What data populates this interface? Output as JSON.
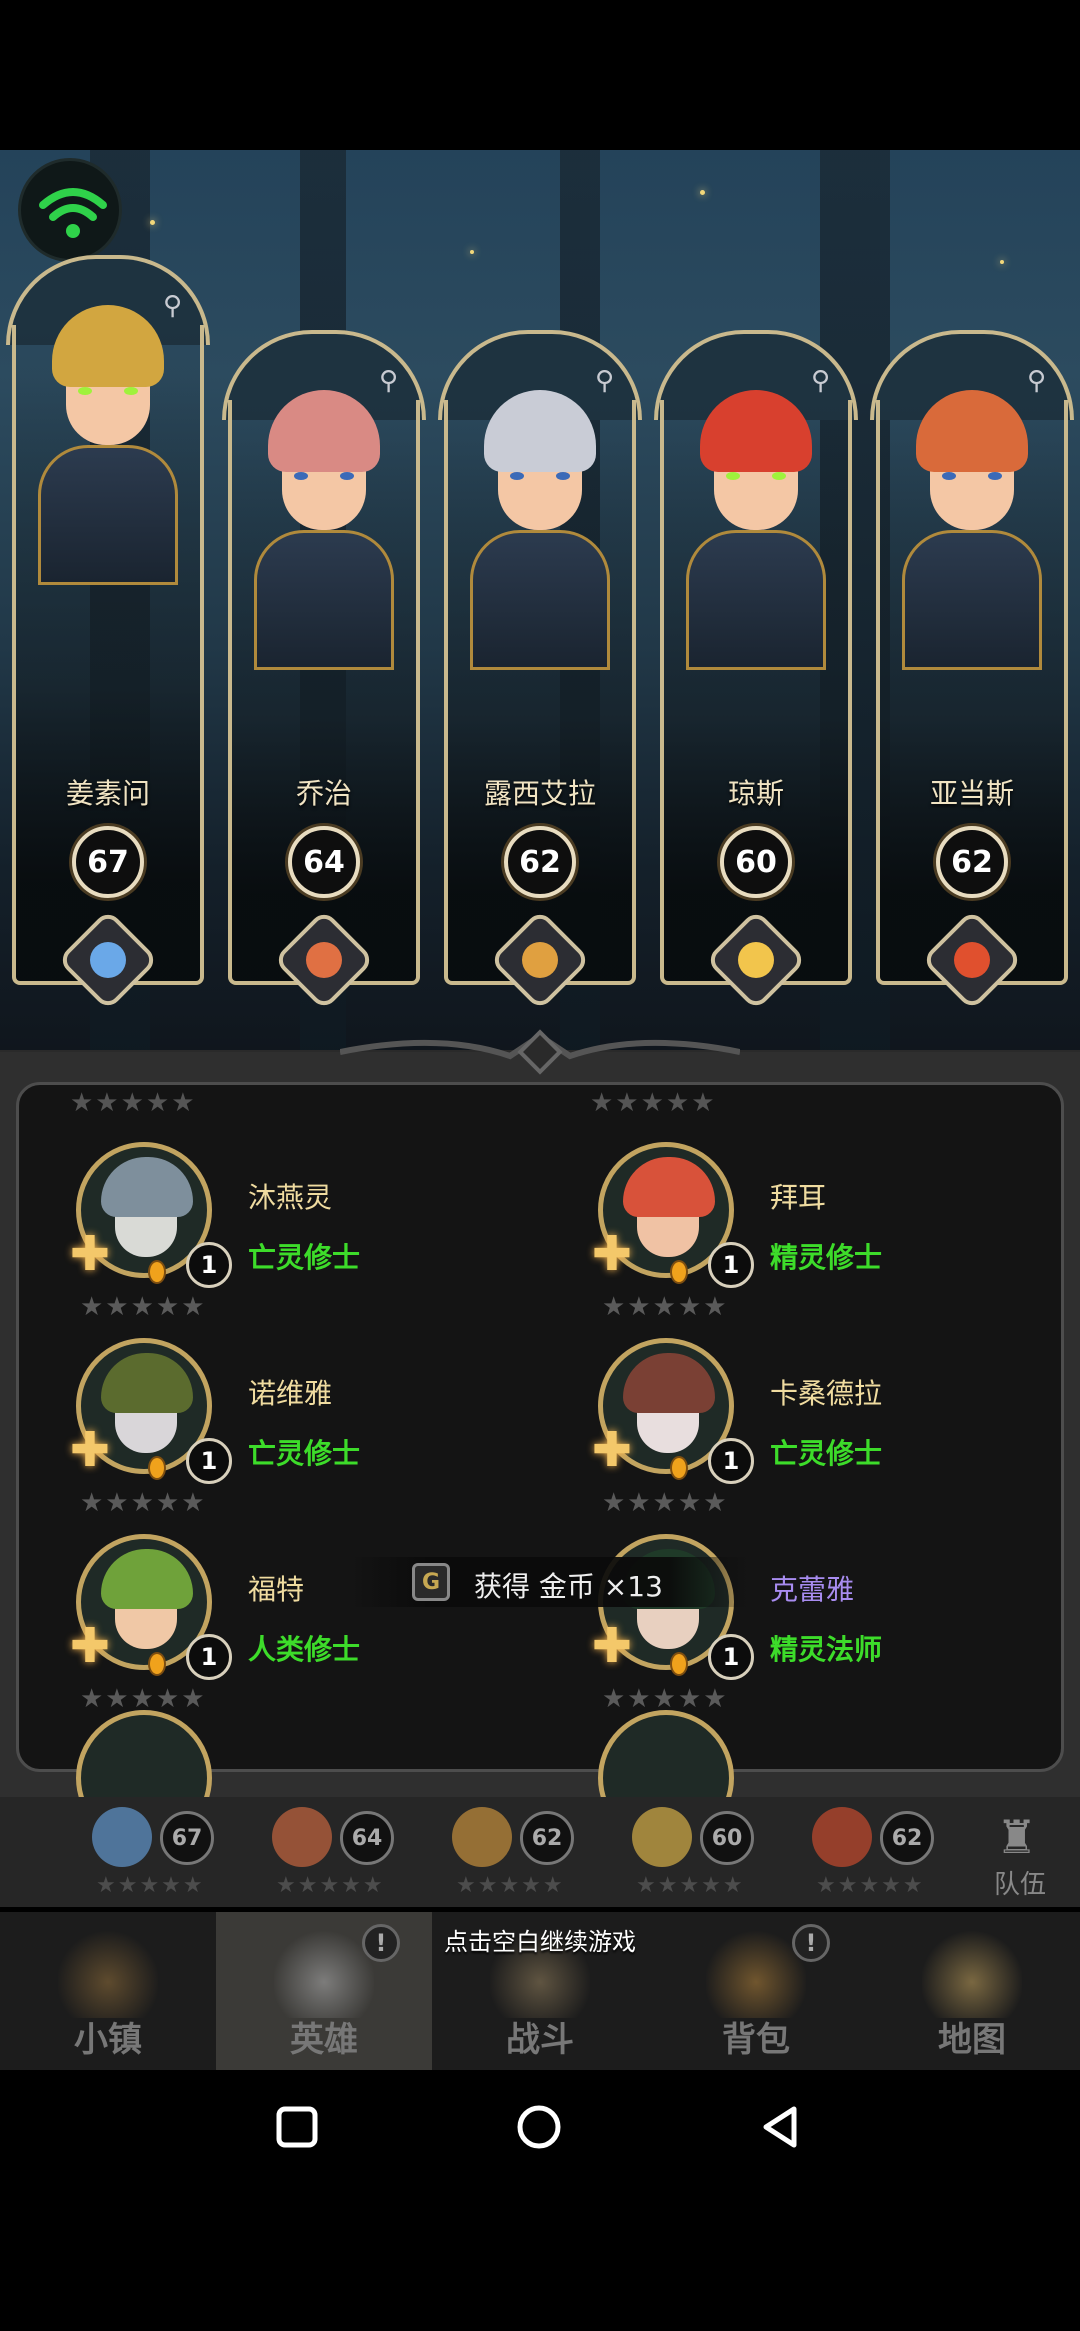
{
  "heroes_top": [
    {
      "name": "姜素问",
      "level": "67",
      "hair": "#d2a640",
      "eye": "#9ff23c",
      "emblem": "#6aa8e8"
    },
    {
      "name": "乔治",
      "level": "64",
      "hair": "#d98a84",
      "eye": "#3b6ab8",
      "emblem": "#e07043"
    },
    {
      "name": "露西艾拉",
      "level": "62",
      "hair": "#c9ccd6",
      "eye": "#3b6ab8",
      "emblem": "#e0a040"
    },
    {
      "name": "琼斯",
      "level": "60",
      "hair": "#d8402e",
      "eye": "#9ff23c",
      "emblem": "#f2c54c"
    },
    {
      "name": "亚当斯",
      "level": "62",
      "hair": "#d96a3a",
      "eye": "#3b6ab8",
      "emblem": "#e0502e"
    }
  ],
  "hero_list": [
    {
      "name": "沐燕灵",
      "role": "亡灵修士",
      "level": "1",
      "role_color": "#3ddc2a",
      "hair": "#7e8f9c",
      "skin": "#d9dad6"
    },
    {
      "name": "拜耳",
      "role": "精灵修士",
      "level": "1",
      "role_color": "#3ddc2a",
      "hair": "#d8523a",
      "skin": "#f0c2a4"
    },
    {
      "name": "诺维雅",
      "role": "亡灵修士",
      "level": "1",
      "role_color": "#3ddc2a",
      "hair": "#5b6b2e",
      "skin": "#d9d6d9"
    },
    {
      "name": "卡桑德拉",
      "role": "亡灵修士",
      "level": "1",
      "role_color": "#3ddc2a",
      "hair": "#7a4034",
      "skin": "#e8dede"
    },
    {
      "name": "福特",
      "role": "人类修士",
      "level": "1",
      "role_color": "#3ddc2a",
      "hair": "#6fa23a",
      "skin": "#f0c8a6"
    },
    {
      "name": "克蕾雅",
      "role": "精灵法师",
      "level": "1",
      "role_color": "#3ddc2a",
      "name_color": "#a88cf0",
      "hair": "#1f3a28",
      "skin": "#e8d0c0"
    }
  ],
  "toast": {
    "text": "获得 金币 ×13",
    "coin_symbol": "G"
  },
  "team": {
    "levels": [
      "67",
      "64",
      "62",
      "60",
      "62"
    ],
    "label": "队伍"
  },
  "nav": {
    "hint": "点击空白继续游戏",
    "items": [
      {
        "label": "小镇"
      },
      {
        "label": "英雄"
      },
      {
        "label": "战斗"
      },
      {
        "label": "背包"
      },
      {
        "label": "地图"
      }
    ],
    "alert_mark": "!"
  },
  "colors": {
    "accent_gold": "#c9b98d",
    "role_green": "#3ddc2a",
    "name_gold": "#f0dca0"
  }
}
